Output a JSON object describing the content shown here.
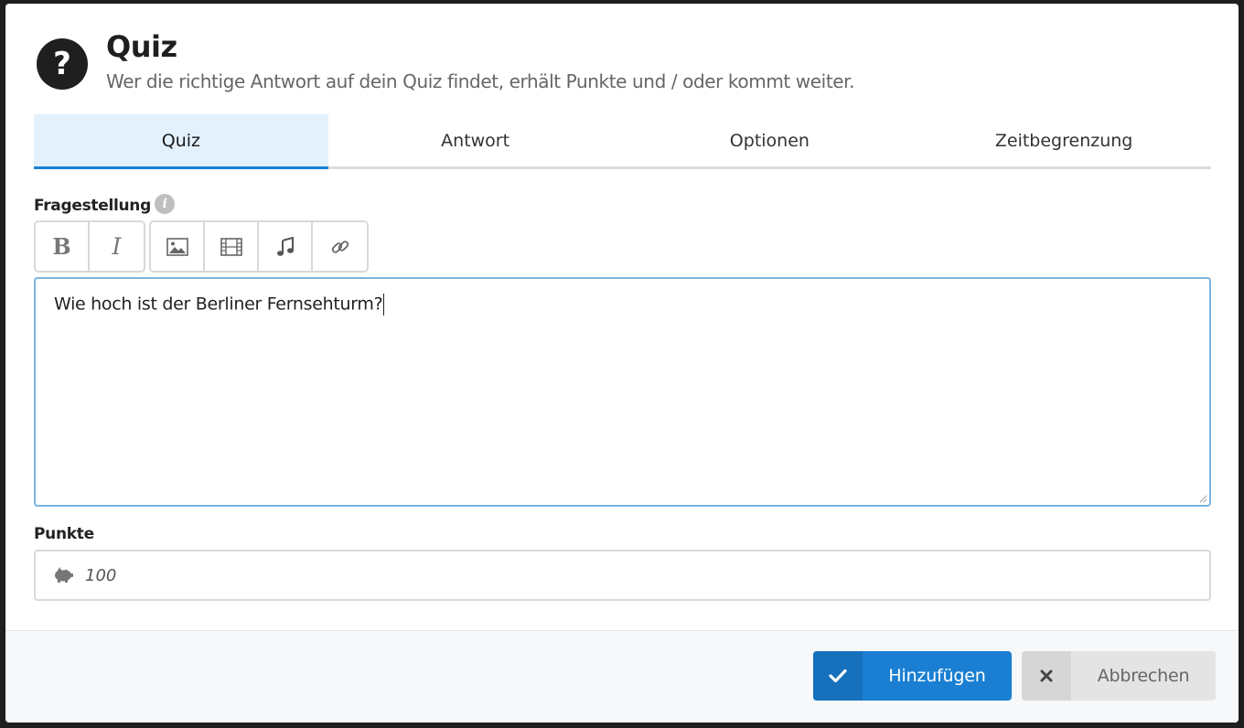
{
  "dialog": {
    "title": "Quiz",
    "subtitle": "Wer die richtige Antwort auf dein Quiz findet, erhält Punkte und / oder kommt weiter.",
    "title_icon": "question-circle-icon"
  },
  "tabs": [
    {
      "label": "Quiz",
      "active": true
    },
    {
      "label": "Antwort",
      "active": false
    },
    {
      "label": "Optionen",
      "active": false
    },
    {
      "label": "Zeitbegrenzung",
      "active": false
    }
  ],
  "question": {
    "label": "Fragestellung",
    "info_icon": "info-icon",
    "toolbar": {
      "format_group": [
        {
          "name": "bold-button",
          "glyph": "B"
        },
        {
          "name": "italic-button",
          "glyph": "I"
        }
      ],
      "media_group": [
        {
          "name": "image-button",
          "icon": "image-icon"
        },
        {
          "name": "video-button",
          "icon": "film-icon"
        },
        {
          "name": "audio-button",
          "icon": "music-note-icon"
        },
        {
          "name": "link-button",
          "icon": "link-icon"
        }
      ]
    },
    "text": "Wie hoch ist der Berliner Fernsehturm?"
  },
  "points": {
    "label": "Punkte",
    "icon": "piggy-bank-icon",
    "placeholder": "100"
  },
  "footer": {
    "add_label": "Hinzufügen",
    "add_icon": "check-icon",
    "cancel_label": "Abbrechen",
    "cancel_icon": "close-icon"
  },
  "colors": {
    "accent": "#1a7fd2",
    "active_tab_bg": "#e3f1fc",
    "editor_focus_border": "#7bb4dc"
  }
}
